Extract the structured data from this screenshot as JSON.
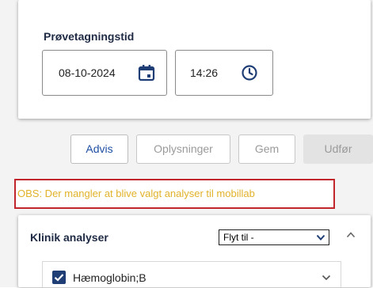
{
  "sample_time": {
    "title": "Prøvetagningstid",
    "date_value": "08-10-2024",
    "time_value": "14:26"
  },
  "actions": {
    "advis": "Advis",
    "oplysninger": "Oplysninger",
    "gem": "Gem",
    "udfor": "Udfør"
  },
  "warning": {
    "text": "OBS: Der mangler at blive valgt analyser til mobillab"
  },
  "analyser": {
    "title": "Klinik analyser",
    "move_select_value": "Flyt til -",
    "items": [
      {
        "label": "Hæmoglobin;B",
        "checked": true
      }
    ]
  },
  "colors": {
    "accent": "#1f4fa3",
    "warning_text": "#e1b22a",
    "warning_border": "#c0262c",
    "checkbox": "#1f3e75"
  },
  "icons": [
    "calendar-icon",
    "clock-icon",
    "chevron-down-icon",
    "chevron-up-icon",
    "checkmark-icon"
  ]
}
